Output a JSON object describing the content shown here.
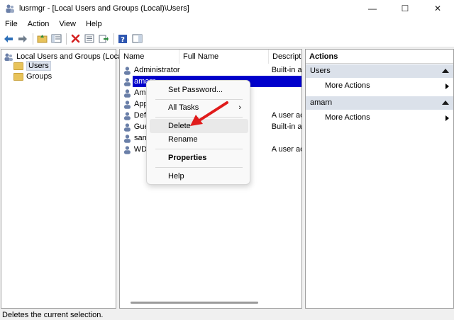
{
  "window": {
    "title": "lusrmgr - [Local Users and Groups (Local)\\Users]",
    "minimize": "—",
    "maximize": "☐",
    "close": "✕"
  },
  "menu": [
    "File",
    "Action",
    "View",
    "Help"
  ],
  "toolbar": {
    "icons": [
      "back-icon",
      "forward-icon",
      "up-folder-icon",
      "show-hide-tree-icon",
      "delete-icon",
      "properties-icon",
      "export-icon",
      "help-icon",
      "action-pane-icon"
    ]
  },
  "tree": {
    "root": "Local Users and Groups (Local)",
    "items": [
      "Users",
      "Groups"
    ]
  },
  "list": {
    "columns": [
      "Name",
      "Full Name",
      "Descriptio"
    ],
    "rows": [
      {
        "name": "Administrator",
        "full": "",
        "desc": "Built-in a"
      },
      {
        "name": "amarn",
        "full": "",
        "desc": ""
      },
      {
        "name": "Ama",
        "full": "",
        "desc": ""
      },
      {
        "name": "App",
        "full": "",
        "desc": ""
      },
      {
        "name": "Defa",
        "full": "",
        "desc": "A user ac"
      },
      {
        "name": "Gue",
        "full": "",
        "desc": "Built-in a"
      },
      {
        "name": "sarn",
        "full": "",
        "desc": ""
      },
      {
        "name": "WDA",
        "full": "",
        "desc": "A user ac"
      }
    ]
  },
  "actions": {
    "title": "Actions",
    "groups": [
      {
        "label": "Users",
        "items": [
          "More Actions"
        ]
      },
      {
        "label": "amarn",
        "items": [
          "More Actions"
        ]
      }
    ]
  },
  "context_menu": {
    "items": [
      "Set Password...",
      "All Tasks",
      "Delete",
      "Rename",
      "Properties",
      "Help"
    ],
    "submenu_glyph": "›"
  },
  "statusbar": {
    "text": "Deletes the current selection."
  },
  "colors": {
    "selection": "#0000cc",
    "annotation_arrow": "#e01b1b",
    "action_group_bg": "#dbe1ea"
  }
}
